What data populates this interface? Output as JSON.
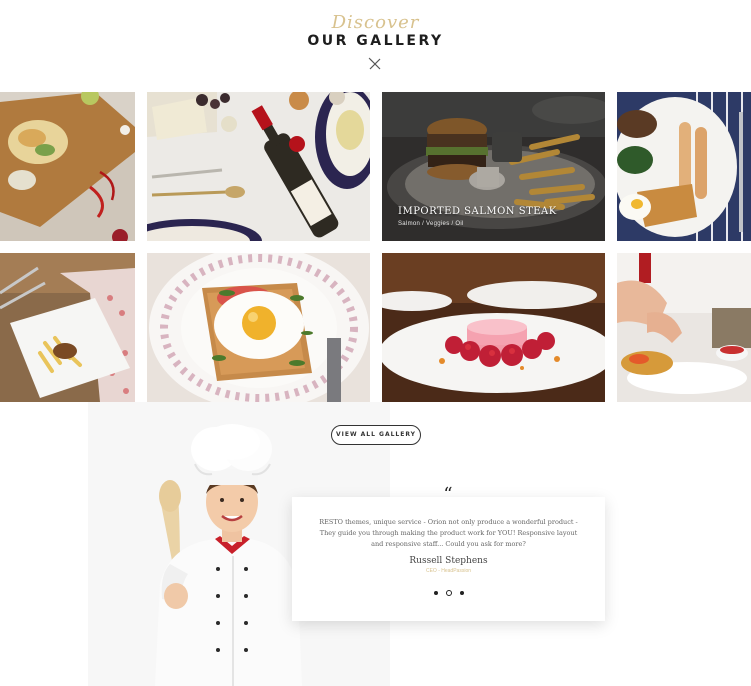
{
  "header": {
    "overline": "Discover",
    "title": "OUR GALLERY",
    "divider_icon": "fork-knife-icon"
  },
  "gallery": {
    "items": [
      {
        "name": "gallery-item-pasta-board"
      },
      {
        "name": "gallery-item-wine-cheese"
      },
      {
        "name": "gallery-item-burger-fries",
        "caption": {
          "title": "IMPORTED SALMON STEAK",
          "subtitle": "Salmon / Veggies / Oil"
        }
      },
      {
        "name": "gallery-item-sausage-breakfast"
      },
      {
        "name": "gallery-item-penne-plate"
      },
      {
        "name": "gallery-item-egg-toast"
      },
      {
        "name": "gallery-item-raspberry-dessert"
      },
      {
        "name": "gallery-item-chef-plating"
      }
    ]
  },
  "buttons": {
    "view_all": "VIEW ALL GALLERY"
  },
  "testimonial": {
    "quote_icon": "quote-icon",
    "text": "RESTO themes, unique service - Orion not only produce a wonderful product - They guide you through making the product work for YOU! Responsive layout and responsive staff... Could you ask for more?",
    "name": "Russell Stephens",
    "role": "CEO - HeadPassion",
    "active_slide": 2,
    "slide_count": 3
  },
  "colors": {
    "accent_gold": "#d8c28e",
    "heading": "#1e1e1e",
    "chef_red": "#c8202a"
  }
}
